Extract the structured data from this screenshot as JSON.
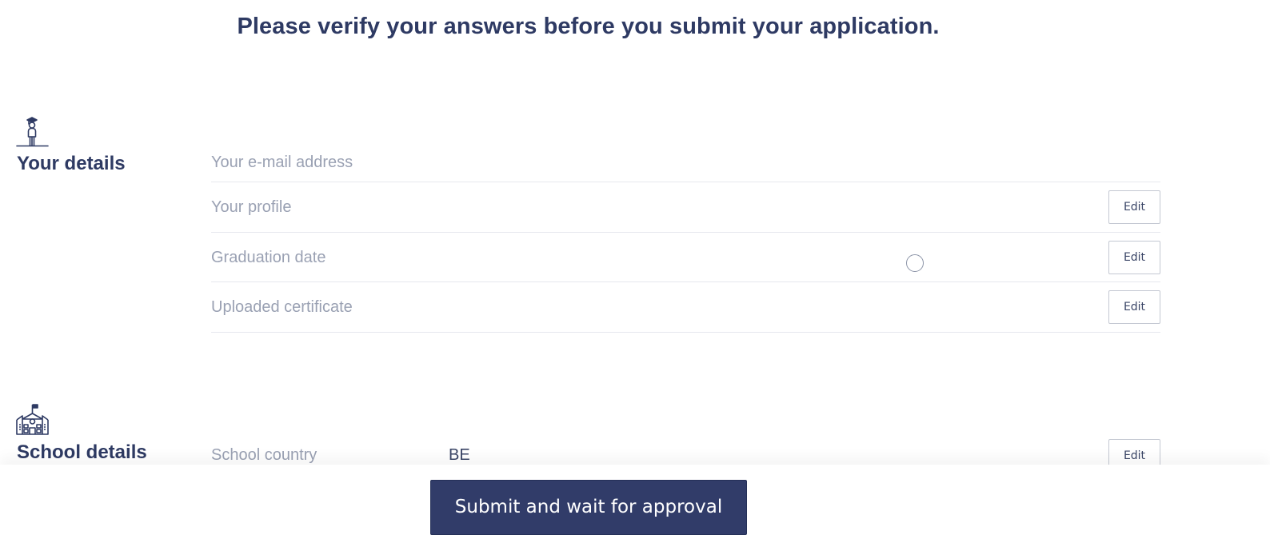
{
  "heading": "Please verify your answers before you submit your application.",
  "sections": {
    "your_details": {
      "title": "Your details",
      "icon": "graduate-icon",
      "rows": [
        {
          "label": "Your e-mail address",
          "value": ""
        },
        {
          "label": "Your profile",
          "value": "",
          "edit_label": "Edit"
        },
        {
          "label": "Graduation date",
          "value": "",
          "edit_label": "Edit"
        },
        {
          "label": "Uploaded certificate",
          "value": "",
          "edit_label": "Edit"
        }
      ]
    },
    "school_details": {
      "title": "School details",
      "icon": "school-building-icon",
      "rows": [
        {
          "label": "School country",
          "value": "BE",
          "edit_label": "Edit"
        }
      ]
    }
  },
  "footer": {
    "submit_label": "Submit and wait for approval"
  },
  "colors": {
    "primary": "#313c69",
    "heading": "#2e3a63",
    "label": "#9aa1b3",
    "divider": "#e6e8ee"
  }
}
